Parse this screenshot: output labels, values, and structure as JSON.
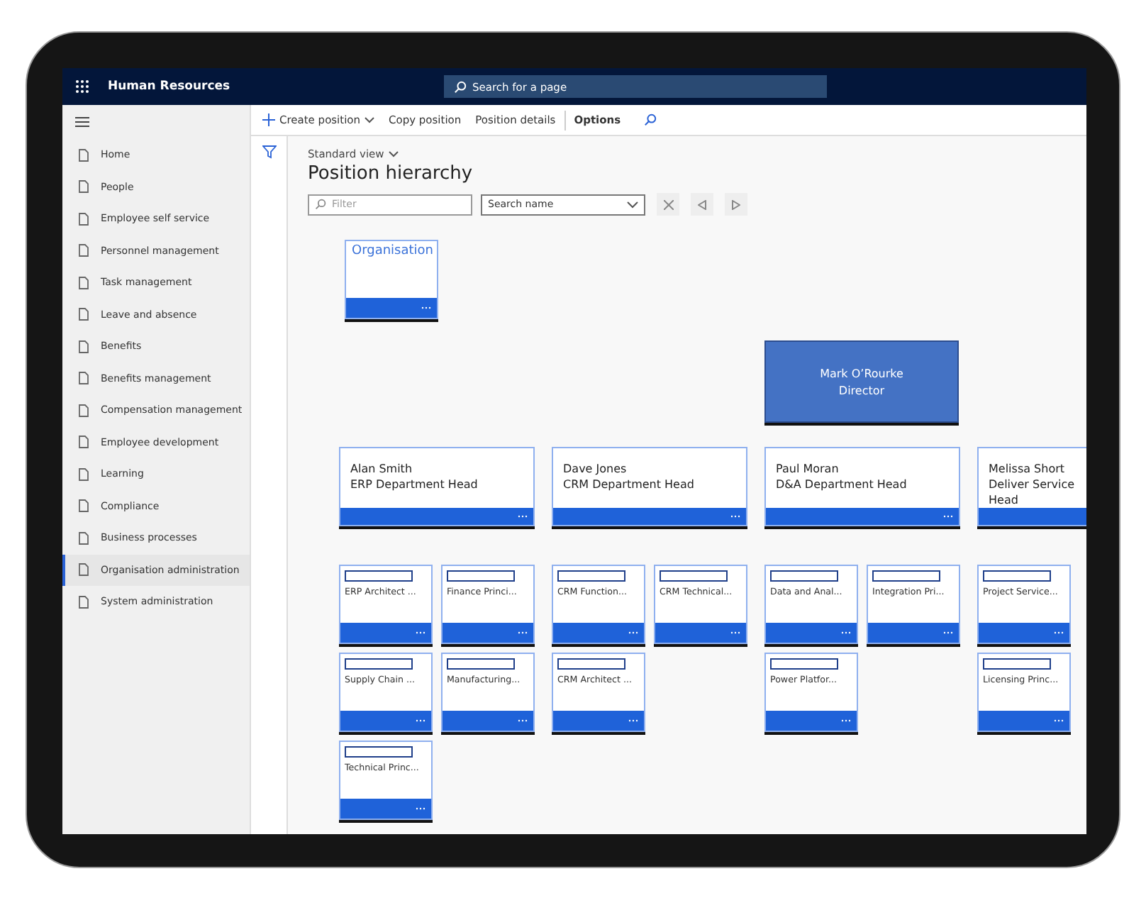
{
  "app": {
    "title": "Human Resources",
    "search_placeholder": "Search for a page"
  },
  "commands": [
    {
      "label": "Create position",
      "kind": "create"
    },
    {
      "label": "Copy position",
      "kind": "plain"
    },
    {
      "label": "Position details",
      "kind": "plain"
    },
    {
      "label": "Options",
      "kind": "options"
    }
  ],
  "nav": {
    "items": [
      {
        "label": "Home",
        "selected": false
      },
      {
        "label": "People",
        "selected": false
      },
      {
        "label": "Employee self service",
        "selected": false
      },
      {
        "label": "Personnel management",
        "selected": false
      },
      {
        "label": "Task management",
        "selected": false
      },
      {
        "label": "Leave and absence",
        "selected": false
      },
      {
        "label": "Benefits",
        "selected": false
      },
      {
        "label": "Benefits management",
        "selected": false
      },
      {
        "label": "Compensation management",
        "selected": false
      },
      {
        "label": "Employee development",
        "selected": false
      },
      {
        "label": "Learning",
        "selected": false
      },
      {
        "label": "Compliance",
        "selected": false
      },
      {
        "label": "Business processes",
        "selected": false
      },
      {
        "label": "Organisation administration",
        "selected": true
      },
      {
        "label": "System administration",
        "selected": false
      }
    ]
  },
  "page": {
    "view": "Standard view",
    "title": "Position hierarchy",
    "filter_placeholder": "Filter",
    "search_select": "Search name"
  },
  "hierarchy": {
    "organisation": {
      "label": "Organisation"
    },
    "director": {
      "name": "Mark O’Rourke",
      "title": "Director"
    },
    "heads": [
      {
        "lines": [
          "Alan Smith",
          "ERP Department Head"
        ],
        "rows": [
          [
            "ERP Architect ...",
            "Finance Princi..."
          ],
          [
            "Supply Chain ...",
            "Manufacturing..."
          ],
          [
            "Technical Princ..."
          ]
        ]
      },
      {
        "lines": [
          "Dave Jones",
          "CRM Department Head"
        ],
        "rows": [
          [
            "CRM Function...",
            "CRM Technical..."
          ],
          [
            "CRM Architect ..."
          ]
        ]
      },
      {
        "lines": [
          "Paul Moran",
          "D&A Department Head"
        ],
        "rows": [
          [
            "Data and Anal...",
            "Integration Pri..."
          ],
          [
            "Power Platfor..."
          ]
        ]
      },
      {
        "lines": [
          "Melissa Short",
          "Deliver Service",
          "Head"
        ],
        "rows": [
          [
            "Project Service..."
          ],
          [
            "Licensing Princ..."
          ]
        ]
      }
    ]
  }
}
